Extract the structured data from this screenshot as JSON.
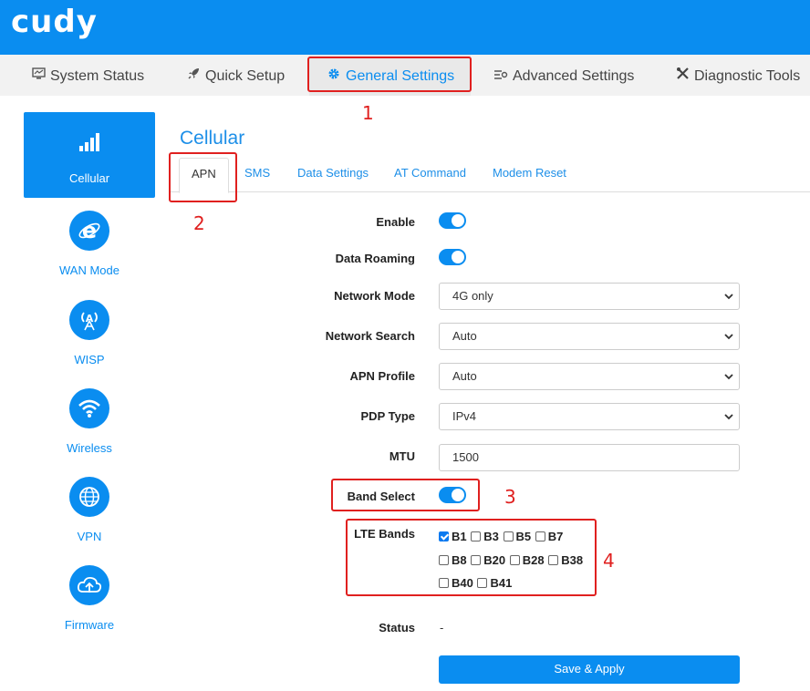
{
  "app": {
    "logo": "cudy",
    "accent": "#0a8df0",
    "annotation_color": "#e0201f"
  },
  "nav": {
    "items": [
      {
        "label": "System Status",
        "icon": "monitor-icon"
      },
      {
        "label": "Quick Setup",
        "icon": "rocket-icon"
      },
      {
        "label": "General Settings",
        "icon": "gear-icon",
        "active": true
      },
      {
        "label": "Advanced Settings",
        "icon": "sliders-icon"
      },
      {
        "label": "Diagnostic Tools",
        "icon": "tools-icon"
      }
    ]
  },
  "sidebar": {
    "items": [
      {
        "label": "Cellular",
        "icon": "signal-bars-icon",
        "active": true
      },
      {
        "label": "WAN Mode",
        "icon": "internet-explorer-icon"
      },
      {
        "label": "WISP",
        "icon": "antenna-icon"
      },
      {
        "label": "Wireless",
        "icon": "wifi-icon"
      },
      {
        "label": "VPN",
        "icon": "globe-icon"
      },
      {
        "label": "Firmware",
        "icon": "cloud-upload-icon"
      }
    ]
  },
  "page": {
    "title": "Cellular"
  },
  "tabs": [
    {
      "label": "APN",
      "active": true
    },
    {
      "label": "SMS"
    },
    {
      "label": "Data Settings"
    },
    {
      "label": "AT Command"
    },
    {
      "label": "Modem Reset"
    }
  ],
  "form": {
    "enable": {
      "label": "Enable",
      "on": true
    },
    "data_roaming": {
      "label": "Data Roaming",
      "on": true
    },
    "network_mode": {
      "label": "Network Mode",
      "value": "4G only"
    },
    "network_search": {
      "label": "Network Search",
      "value": "Auto"
    },
    "apn_profile": {
      "label": "APN Profile",
      "value": "Auto"
    },
    "pdp_type": {
      "label": "PDP Type",
      "value": "IPv4"
    },
    "mtu": {
      "label": "MTU",
      "value": "1500"
    },
    "band_select": {
      "label": "Band Select",
      "on": true
    },
    "lte_bands": {
      "label": "LTE Bands",
      "bands": [
        {
          "name": "B1",
          "checked": true
        },
        {
          "name": "B3",
          "checked": false
        },
        {
          "name": "B5",
          "checked": false
        },
        {
          "name": "B7",
          "checked": false
        },
        {
          "name": "B8",
          "checked": false
        },
        {
          "name": "B20",
          "checked": false
        },
        {
          "name": "B28",
          "checked": false
        },
        {
          "name": "B38",
          "checked": false
        },
        {
          "name": "B40",
          "checked": false
        },
        {
          "name": "B41",
          "checked": false
        }
      ]
    },
    "status": {
      "label": "Status",
      "value": "-"
    },
    "save_label": "Save & Apply"
  },
  "annotations": [
    "1",
    "2",
    "3",
    "4"
  ]
}
